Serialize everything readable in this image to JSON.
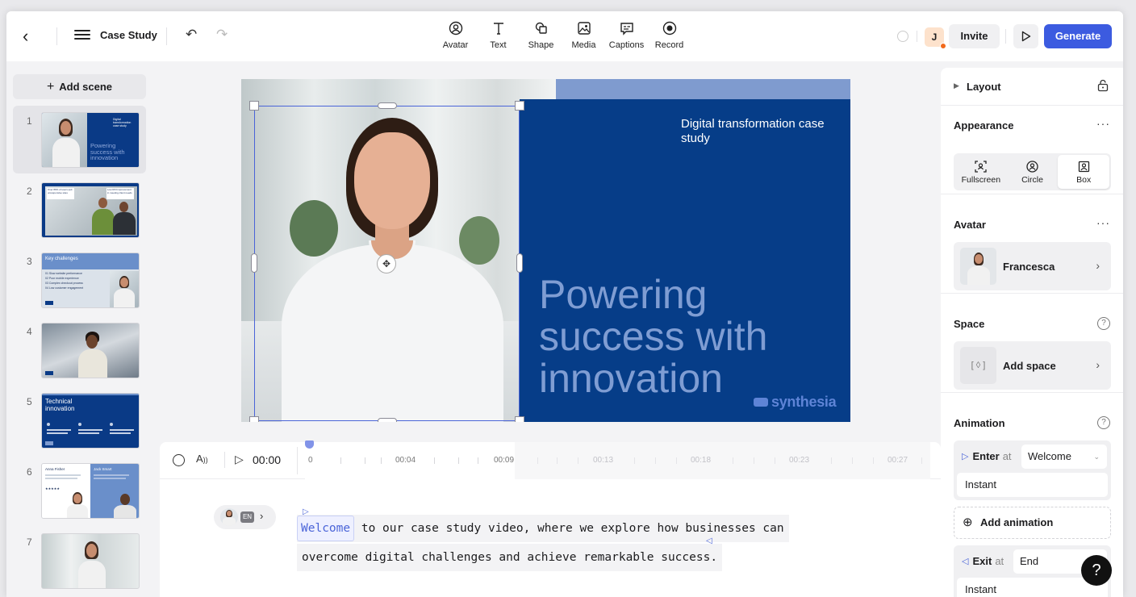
{
  "header": {
    "project_title": "Case Study",
    "tools": [
      {
        "label": "Avatar",
        "icon": "avatar-icon"
      },
      {
        "label": "Text",
        "icon": "text-icon"
      },
      {
        "label": "Shape",
        "icon": "shape-icon"
      },
      {
        "label": "Media",
        "icon": "media-icon"
      },
      {
        "label": "Captions",
        "icon": "captions-icon"
      },
      {
        "label": "Record",
        "icon": "record-icon"
      }
    ],
    "user_initial": "J",
    "invite_label": "Invite",
    "generate_label": "Generate",
    "brand_color": "#3c5be0"
  },
  "scenes": {
    "add_label": "Add scene",
    "items": [
      {
        "num": "1",
        "text": "Powering success with innovation",
        "small": "Digital transformation case study"
      },
      {
        "num": "2",
        "t1": "Over 80% of users quit unresponsive sites",
        "t2": "Low ROI improvement in meeting client needs"
      },
      {
        "num": "3",
        "heading": "Key challenges",
        "list": [
          "01  Slow website performance",
          "02  Poor mobile experience",
          "03  Complex checkout process",
          "04  Low customer engagement"
        ]
      },
      {
        "num": "4"
      },
      {
        "num": "5",
        "heading": "Technical innovation"
      },
      {
        "num": "6",
        "name_a": "Anna Fisher",
        "name_b": "Jack Smart",
        "stars": "★★★★★"
      },
      {
        "num": "7"
      }
    ]
  },
  "slide": {
    "subtitle": "Digital transformation case study",
    "headline": "Powering success with innovation",
    "logo_text": "synthesia",
    "panel_color": "#063d88",
    "headline_color": "#7f9dd3"
  },
  "timeline": {
    "current_time": "00:00",
    "labels": [
      "0",
      "00:04",
      "00:09",
      "00:13",
      "00:18",
      "00:23",
      "00:27"
    ]
  },
  "script": {
    "language": "EN",
    "highlight_word": "Welcome",
    "line1_rest": " to our case study video, where we explore how businesses can",
    "line2": "overcome digital challenges and achieve remarkable success."
  },
  "panel": {
    "layout_label": "Layout",
    "appearance_title": "Appearance",
    "appearance_options": [
      "Fullscreen",
      "Circle",
      "Box"
    ],
    "appearance_selected": "Box",
    "avatar_title": "Avatar",
    "avatar_name": "Francesca",
    "space_title": "Space",
    "space_label": "Add space",
    "animation_title": "Animation",
    "enter_label": "Enter",
    "exit_label": "Exit",
    "at_label": "at",
    "enter_at": "Welcome",
    "exit_at": "End",
    "enter_type": "Instant",
    "exit_type": "Instant",
    "add_animation_label": "Add animation"
  }
}
